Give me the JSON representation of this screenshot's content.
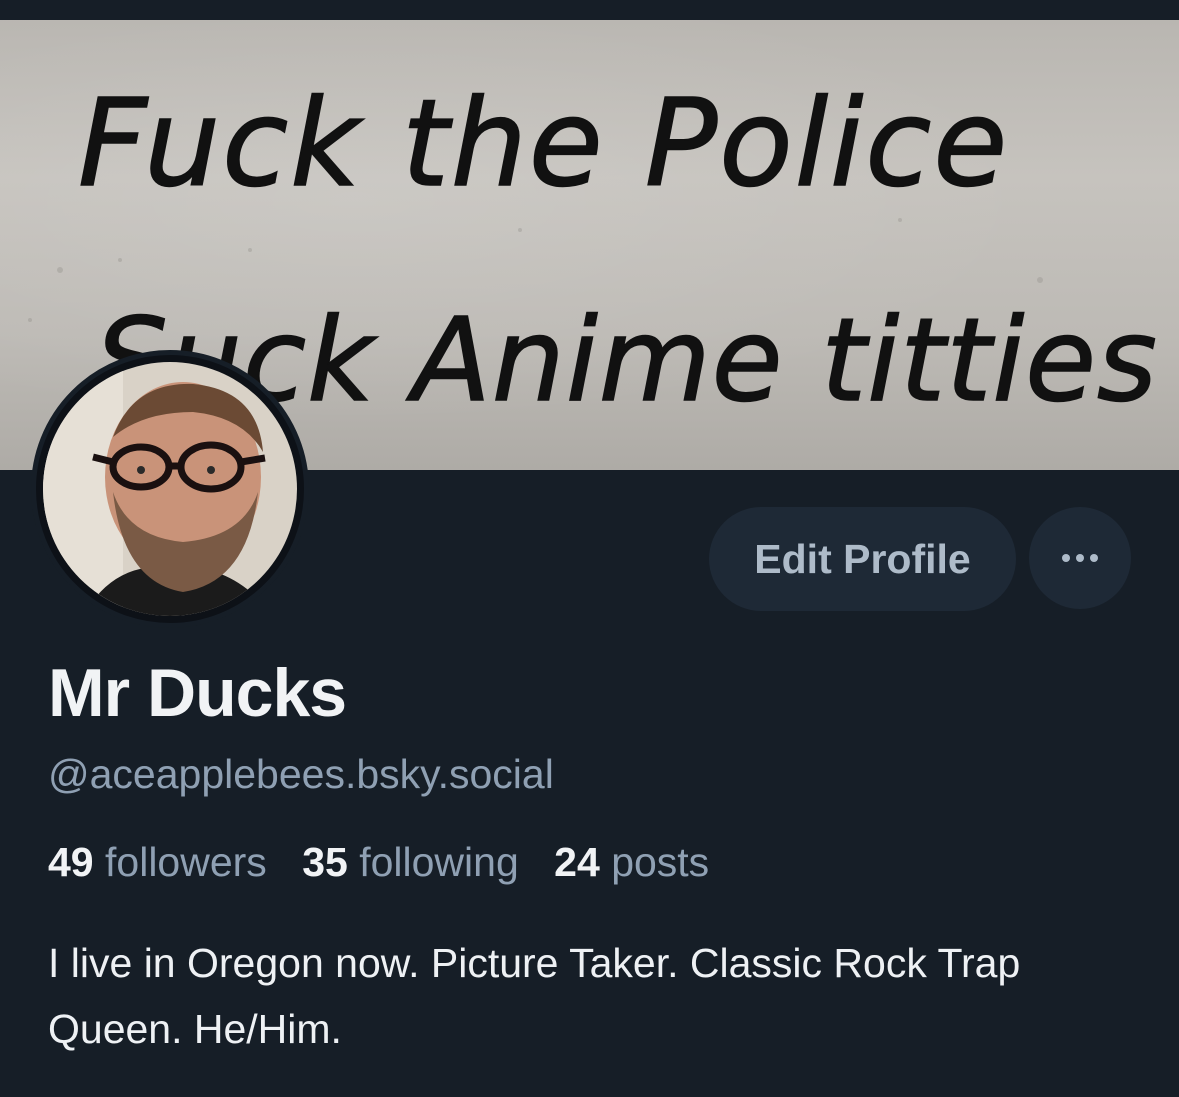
{
  "banner": {
    "image_description_icon": "banner-image",
    "graffiti_line_1": "Fuck the Police",
    "graffiti_line_2": "Suck Anime titties"
  },
  "avatar": {
    "icon": "avatar-photo"
  },
  "actions": {
    "edit_profile_label": "Edit Profile",
    "more_icon": "more-horizontal-icon"
  },
  "profile": {
    "display_name": "Mr Ducks",
    "handle": "@aceapplebees.bsky.social"
  },
  "stats": {
    "followers_count": "49",
    "followers_label": "followers",
    "following_count": "35",
    "following_label": "following",
    "posts_count": "24",
    "posts_label": "posts"
  },
  "bio": {
    "text": "I live in Oregon now. Picture Taker. Classic Rock Trap Queen. He/Him."
  },
  "colors": {
    "background": "#161e27",
    "button_bg": "#1e2936",
    "muted_text": "#8fa0b3",
    "primary_text": "#f1f3f5"
  }
}
